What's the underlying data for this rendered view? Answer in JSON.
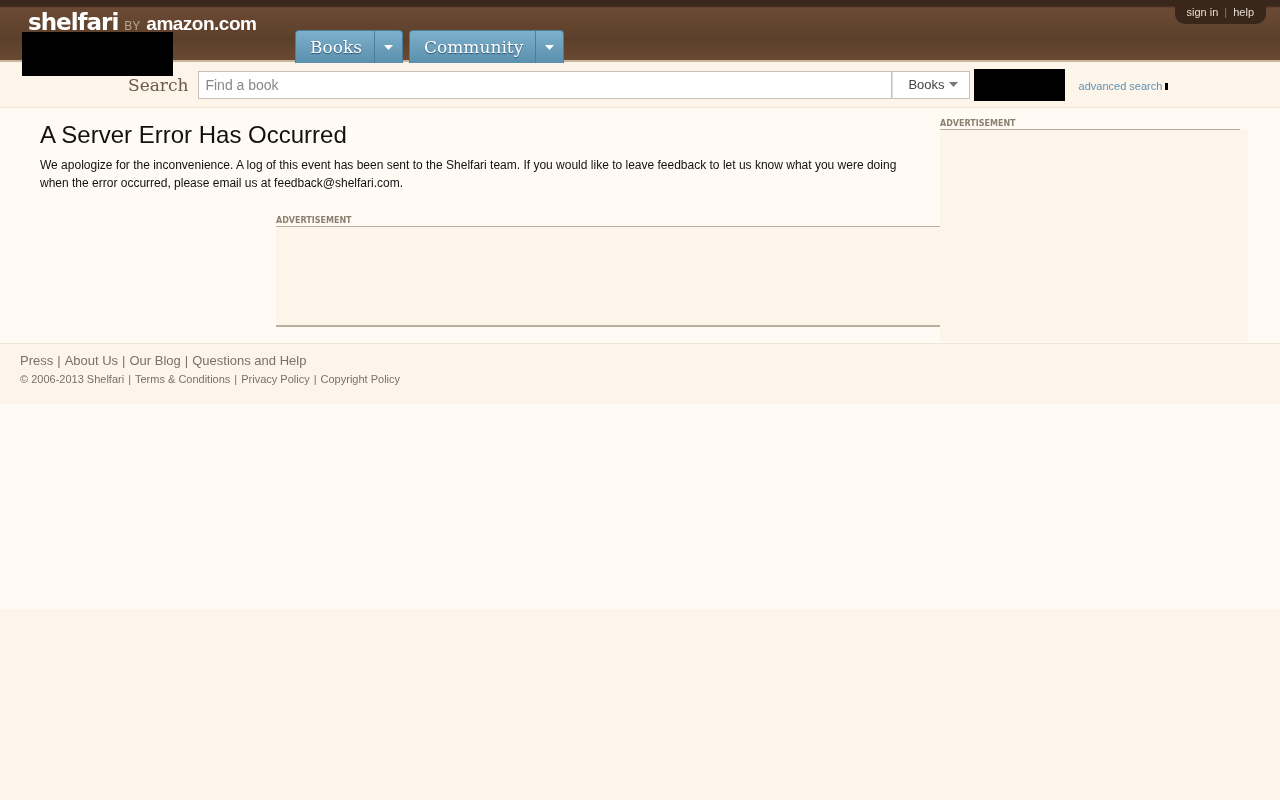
{
  "logo": {
    "name": "shelfari",
    "byline": "BY",
    "partner": "amazon.com"
  },
  "nav_tabs": [
    {
      "label": "Books"
    },
    {
      "label": "Community"
    }
  ],
  "user_links": {
    "items": [
      "sign in",
      "help"
    ],
    "separator": "|"
  },
  "search": {
    "label": "Search",
    "placeholder": "Find a book",
    "scope": "Books",
    "advanced_link": "advanced search"
  },
  "error": {
    "title": "A Server Error Has Occurred",
    "message": "We apologize for the inconvenience. A log of this event has been sent to the Shelfari team. If you would like to leave feedback to let us know what you were doing when the error occurred, please email us at feedback@shelfari.com."
  },
  "sidebar_ad": {
    "label": "ADVERTISEMENT"
  },
  "inline_ad": {
    "label": "ADVERTISEMENT"
  },
  "footer": {
    "separator": "|",
    "links": [
      "Press",
      "About Us",
      "Our Blog",
      "Questions and Help"
    ],
    "copyright": "© 2006-2013 Shelfari",
    "legal_links": [
      "Terms & Conditions",
      "Privacy Policy",
      "Copyright Policy"
    ]
  }
}
